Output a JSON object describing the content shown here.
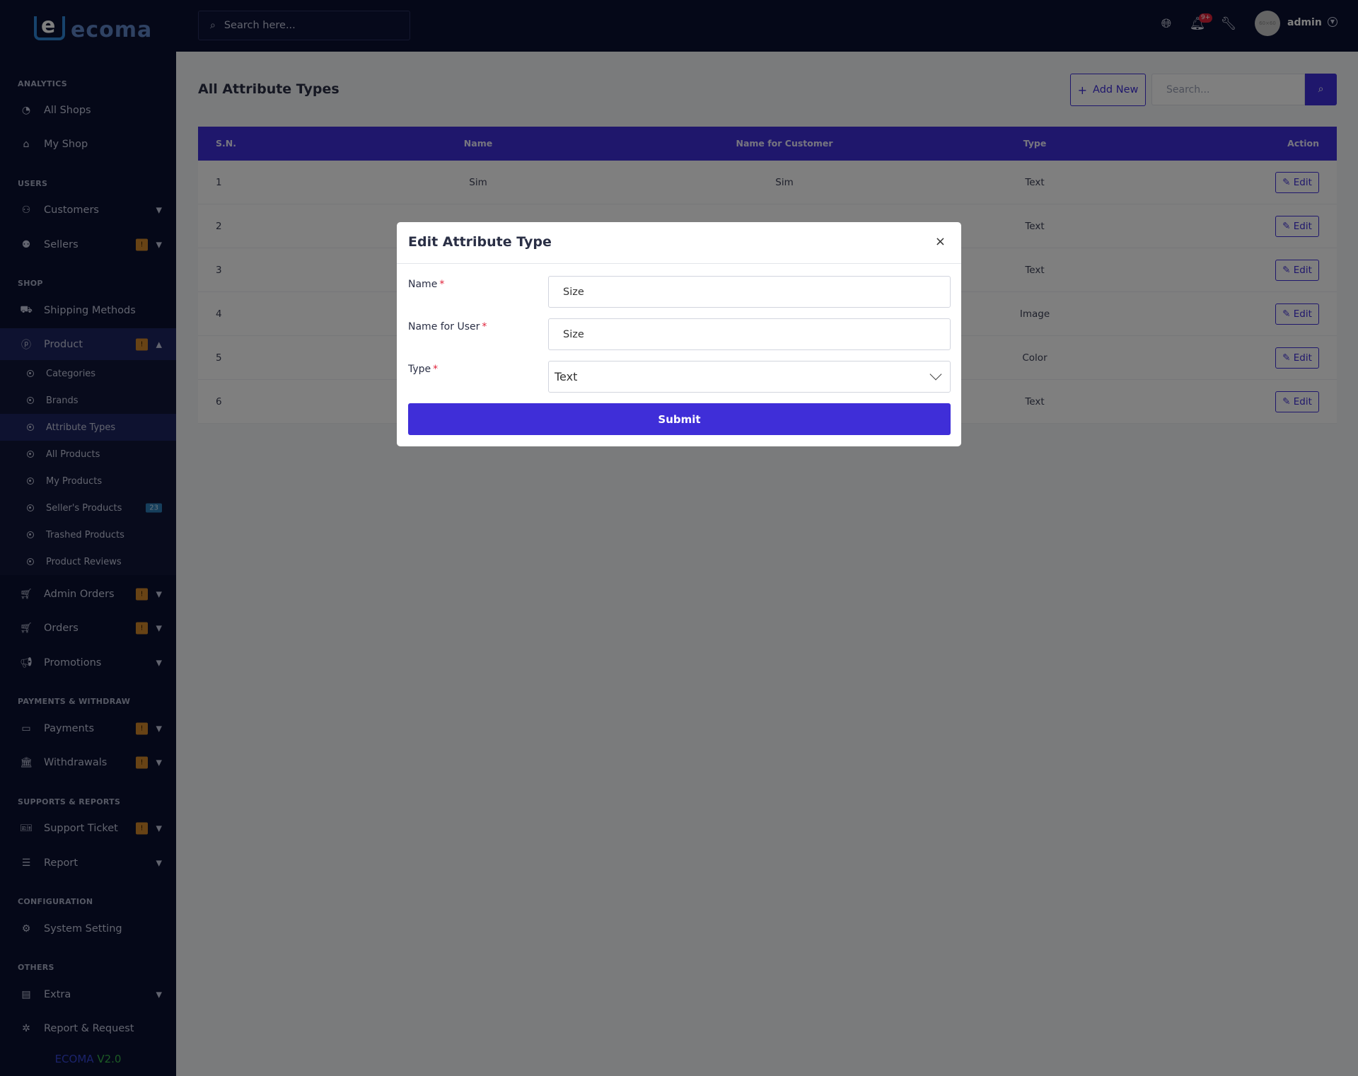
{
  "app": {
    "logo_text": "ecoma",
    "logo_letter": "e",
    "version_name": "ECOMA",
    "version_num": "V2.0"
  },
  "topbar": {
    "search_placeholder": "Search here...",
    "notif_count": "9+",
    "avatar_text": "60×60",
    "user_name": "admin"
  },
  "sidebar": {
    "sections": {
      "analytics": "ANALYTICS",
      "users": "USERS",
      "shop": "SHOP",
      "payments": "PAYMENTS & WITHDRAW",
      "supports": "SUPPORTS & REPORTS",
      "configuration": "CONFIGURATION",
      "others": "OTHERS"
    },
    "items": {
      "all_shops": "All Shops",
      "my_shop": "My Shop",
      "customers": "Customers",
      "sellers": "Sellers",
      "shipping": "Shipping Methods",
      "product": "Product",
      "admin_orders": "Admin Orders",
      "orders": "Orders",
      "promotions": "Promotions",
      "payments": "Payments",
      "withdrawals": "Withdrawals",
      "support_ticket": "Support Ticket",
      "report": "Report",
      "system_setting": "System Setting",
      "extra": "Extra",
      "report_request": "Report & Request"
    },
    "warn_badge": "!",
    "product_sub": [
      {
        "label": "Categories"
      },
      {
        "label": "Brands"
      },
      {
        "label": "Attribute Types"
      },
      {
        "label": "All Products"
      },
      {
        "label": "My Products"
      },
      {
        "label": "Seller's Products",
        "count": "23"
      },
      {
        "label": "Trashed Products"
      },
      {
        "label": "Product Reviews"
      }
    ]
  },
  "main": {
    "title": "All Attribute Types",
    "add_new": "Add New",
    "search_placeholder": "Search...",
    "table": {
      "headers": {
        "sn": "S.N.",
        "name": "Name",
        "name_customer": "Name for Customer",
        "type": "Type",
        "action": "Action"
      },
      "edit_label": "Edit",
      "rows": [
        {
          "sn": "1",
          "name": "Sim",
          "name_customer": "Sim",
          "type": "Text"
        },
        {
          "sn": "2",
          "name": "",
          "name_customer": "",
          "type": "Text"
        },
        {
          "sn": "3",
          "name": "",
          "name_customer": "",
          "type": "Text"
        },
        {
          "sn": "4",
          "name": "",
          "name_customer": "",
          "type": "Image"
        },
        {
          "sn": "5",
          "name": "",
          "name_customer": "",
          "type": "Color"
        },
        {
          "sn": "6",
          "name": "",
          "name_customer": "",
          "type": "Text"
        }
      ]
    }
  },
  "modal": {
    "title": "Edit Attribute Type",
    "close": "×",
    "name_label": "Name",
    "name_value": "Size",
    "name_user_label": "Name for User",
    "name_user_value": "Size",
    "type_label": "Type",
    "type_value": "Text",
    "required_mark": "*",
    "submit": "Submit"
  },
  "colors": {
    "primary": "#3f2ed8",
    "sidebar_bg": "#0a1030",
    "warn": "#d0872b"
  }
}
